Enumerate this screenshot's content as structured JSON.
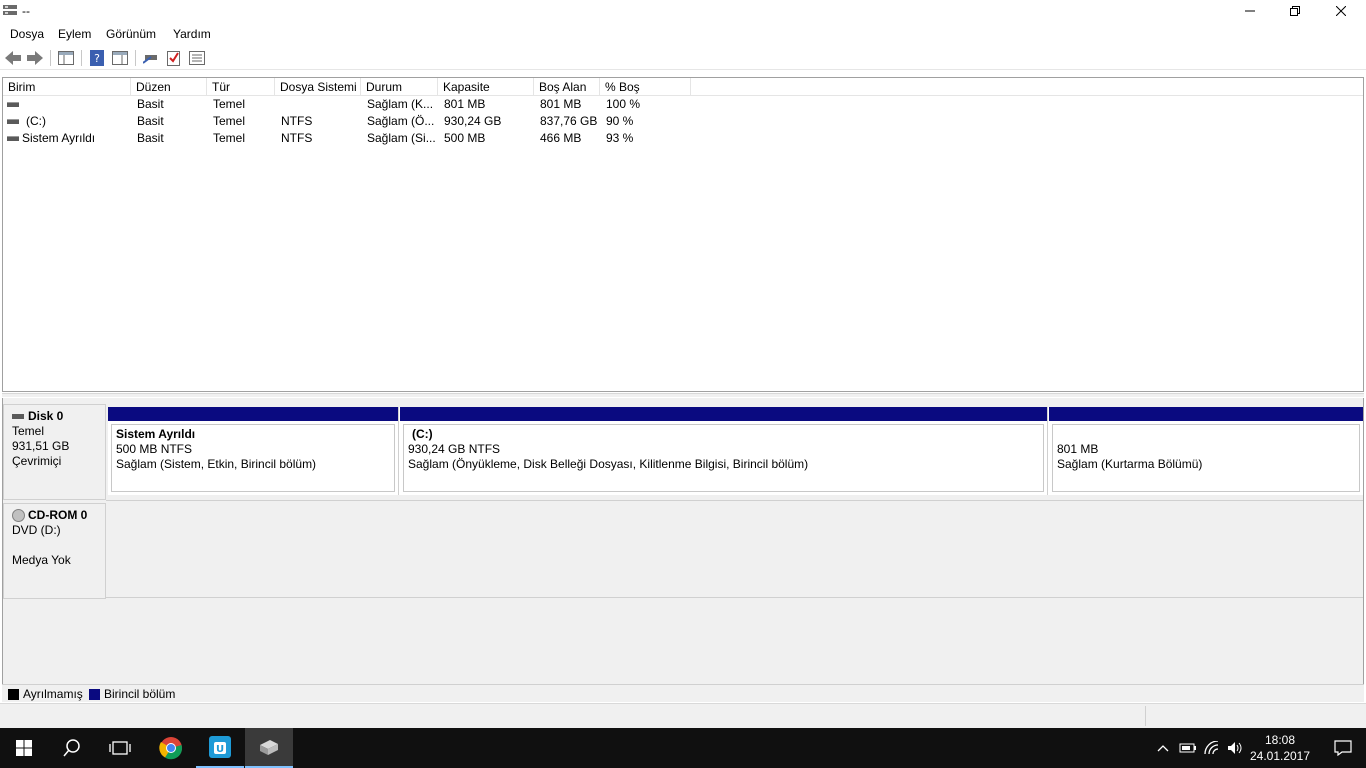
{
  "window": {
    "title": "--",
    "icon": "disk-management-icon"
  },
  "menu": [
    "Dosya",
    "Eylem",
    "Görünüm",
    "Yardım"
  ],
  "toolbar": {
    "icons": [
      "back-arrow-icon",
      "forward-arrow-icon",
      "console-tree-icon",
      "help-icon",
      "show-hide-pane-icon",
      "connect-icon",
      "check-icon",
      "properties-icon"
    ]
  },
  "volume_list": {
    "columns": [
      "Birim",
      "Düzen",
      "Tür",
      "Dosya Sistemi",
      "Durum",
      "Kapasite",
      "Boş Alan",
      "% Boş"
    ],
    "rows": [
      [
        "",
        "Basit",
        "Temel",
        "",
        "Sağlam (K...",
        "801 MB",
        "801 MB",
        "100 %"
      ],
      [
        "(C:)",
        "Basit",
        "Temel",
        "NTFS",
        "Sağlam (Ö...",
        "930,24 GB",
        "837,76 GB",
        "90 %"
      ],
      [
        "Sistem Ayrıldı",
        "Basit",
        "Temel",
        "NTFS",
        "Sağlam (Si...",
        "500 MB",
        "466 MB",
        "93 %"
      ]
    ]
  },
  "disks": [
    {
      "name": "Disk 0",
      "type": "Temel",
      "size": "931,51 GB",
      "status": "Çevrimiçi",
      "partitions": [
        {
          "title": "Sistem Ayrıldı",
          "line1": "500 MB NTFS",
          "line2": "Sağlam (Sistem, Etkin, Birincil bölüm)"
        },
        {
          "title": "(C:)",
          "line1": "930,24 GB NTFS",
          "line2": "Sağlam (Önyükleme, Disk Belleği Dosyası, Kilitlenme Bilgisi, Birincil bölüm)"
        },
        {
          "title": "",
          "line1": "801 MB",
          "line2": "Sağlam (Kurtarma Bölümü)"
        }
      ]
    },
    {
      "name": "CD-ROM 0",
      "type": "DVD (D:)",
      "size": "",
      "status": "Medya Yok"
    }
  ],
  "legend": [
    {
      "label": "Ayrılmamış",
      "color": "#000000"
    },
    {
      "label": "Birincil bölüm",
      "color": "#0a0a80"
    }
  ],
  "taskbar": {
    "icons": [
      "windows-start-icon",
      "search-icon",
      "task-view-icon",
      "chrome-icon",
      "store-app-icon",
      "disk-management-app-icon"
    ],
    "tray_icons": [
      "chevron-up-icon",
      "battery-icon",
      "wifi-icon",
      "volume-icon",
      "action-center-icon"
    ],
    "time": "18:08",
    "date": "24.01.2017"
  }
}
